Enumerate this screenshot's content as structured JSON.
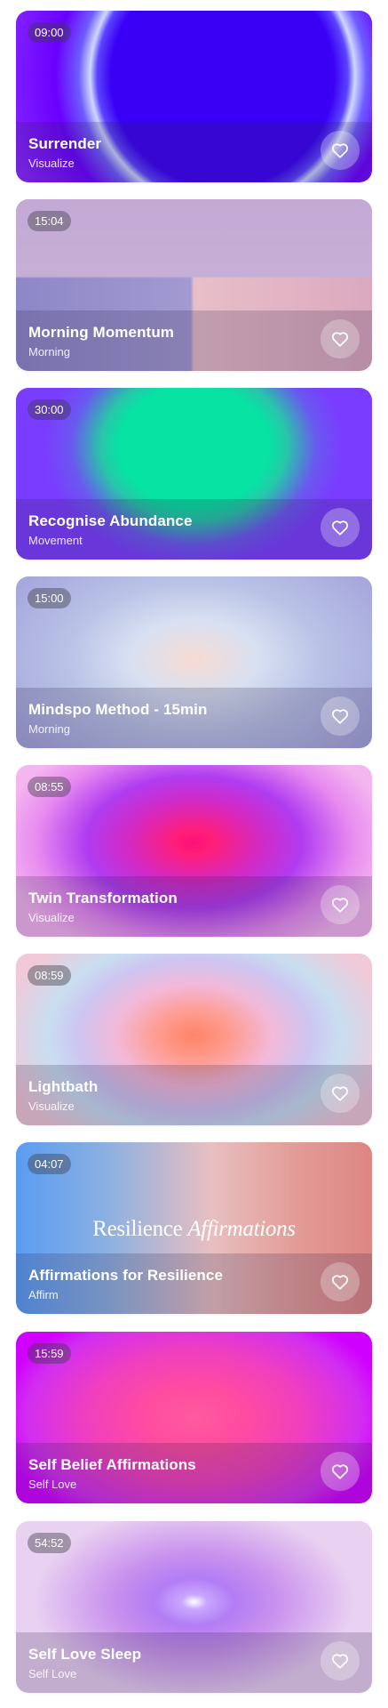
{
  "items": [
    {
      "duration": "09:00",
      "title": "Surrender",
      "category": "Visualize"
    },
    {
      "duration": "15:04",
      "title": "Morning Momentum",
      "category": "Morning"
    },
    {
      "duration": "30:00",
      "title": "Recognise Abundance",
      "category": "Movement"
    },
    {
      "duration": "15:00",
      "title": "Mindspo Method - 15min",
      "category": "Morning"
    },
    {
      "duration": "08:55",
      "title": "Twin Transformation",
      "category": "Visualize"
    },
    {
      "duration": "08:59",
      "title": "Lightbath",
      "category": "Visualize"
    },
    {
      "duration": "04:07",
      "title": "Affirmations for Resilience",
      "category": "Affirm",
      "artwork_text": "Resilience",
      "artwork_text_accent": "Affirmations"
    },
    {
      "duration": "15:59",
      "title": "Self Belief Affirmations",
      "category": "Self Love"
    },
    {
      "duration": "54:52",
      "title": "Self Love Sleep",
      "category": "Self Love"
    }
  ],
  "icons": {
    "favorite": "heart-outline-icon"
  }
}
